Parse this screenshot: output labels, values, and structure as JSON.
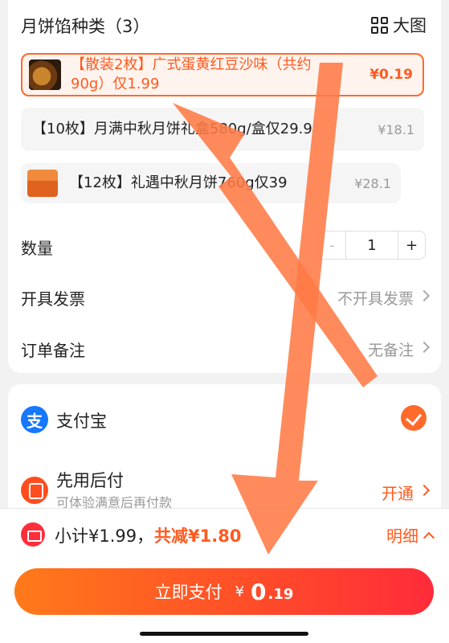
{
  "spec": {
    "header": "月饼馅种类（3）",
    "view_label": "大图",
    "options": [
      {
        "text": "【散装2枚】广式蛋黄红豆沙味（共约90g）仅1.99",
        "price": "¥0.19",
        "selected": true
      },
      {
        "text": "【10枚】月满中秋月饼礼盒580g/盒仅29.9",
        "price": "¥18.1",
        "selected": false
      },
      {
        "text": "【12枚】礼遇中秋月饼760g仅39",
        "price": "¥28.1",
        "selected": false
      }
    ]
  },
  "quantity": {
    "label": "数量",
    "minus": "-",
    "value": "1",
    "plus": "+"
  },
  "invoice": {
    "label": "开具发票",
    "value": "不开具发票"
  },
  "note": {
    "label": "订单备注",
    "value": "无备注"
  },
  "payment": {
    "alipay": {
      "icon_text": "支",
      "label": "支付宝"
    },
    "paylater": {
      "label": "先用后付",
      "sub": "可体验满意后再付款",
      "action": "开通"
    }
  },
  "summary": {
    "subtotal": "小计¥1.99，",
    "discount": "共减¥1.80",
    "detail": "明细"
  },
  "pay_button": {
    "label": "立即支付",
    "yen": "¥",
    "amount_main": "0",
    "amount_decimal": ".19"
  },
  "colors": {
    "accent": "#ff6a2b",
    "alipay": "#1677ff",
    "annotation_arrow": "#ff7a45"
  }
}
